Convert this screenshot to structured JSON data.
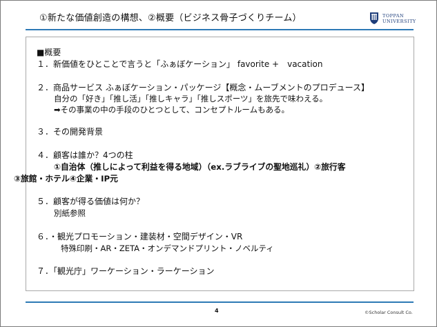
{
  "header": {
    "title": "①新たな価値創造の構想、②概要（ビジネス骨子づくりチーム）"
  },
  "logo": {
    "line1": "TOPPAN",
    "line2": "UNIVERSITY",
    "color": "#1d3d7a"
  },
  "accent_color": "#2c79b5",
  "content": {
    "lines": [
      "■概要",
      "１．新価値をひとことで言うと「ふぁぼケーション」 favorite +　vacation",
      "２．商品サービス ふぁぼケーション・パッケージ【概念・ムーブメントのプロデュース】",
      "自分の「好き」「推し活」「推しキャラ」「推しスポーツ」を旅先で味わえる。",
      "➡その事業の中の手段のひとつとして、コンセプトルームもある。",
      "３．その開発背景",
      "４．顧客は誰か？4つの柱",
      "①自治体（推しによって利益を得る地域）（ex.ラブライブの聖地巡礼）②旅行客",
      "③旅館・ホテル④企業・IP元",
      "５．顧客が得る価値は何か？",
      "別紙参照",
      "６．・観光プロモーション・建装材・空間デザイン・VR",
      "特殊印刷・AR・ZETA・オンデマンドプリント・ノベルティ",
      "７．「観光庁」ワーケーション・ラーケーション"
    ]
  },
  "footer": {
    "page_number": "4",
    "copyright": "©Scholar Consult Co."
  }
}
